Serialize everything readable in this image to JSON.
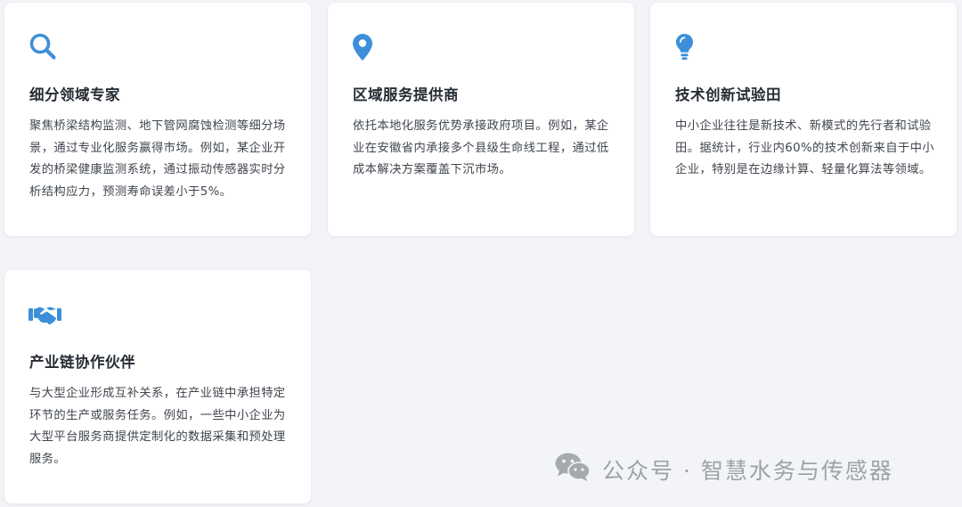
{
  "theme": {
    "accent": "#3d8fd9",
    "card_background": "#ffffff",
    "page_background": "#f3f4f8"
  },
  "cards": [
    {
      "icon": "search-icon",
      "title": "细分领域专家",
      "description": "聚焦桥梁结构监测、地下管网腐蚀检测等细分场景，通过专业化服务赢得市场。例如，某企业开发的桥梁健康监测系统，通过振动传感器实时分析结构应力，预测寿命误差小于5%。"
    },
    {
      "icon": "map-pin-icon",
      "title": "区域服务提供商",
      "description": "依托本地化服务优势承接政府项目。例如，某企业在安徽省内承接多个县级生命线工程，通过低成本解决方案覆盖下沉市场。"
    },
    {
      "icon": "lightbulb-icon",
      "title": "技术创新试验田",
      "description": "中小企业往往是新技术、新模式的先行者和试验田。据统计，行业内60%的技术创新来自于中小企业，特别是在边缘计算、轻量化算法等领域。"
    },
    {
      "icon": "handshake-icon",
      "title": "产业链协作伙伴",
      "description": "与大型企业形成互补关系，在产业链中承担特定环节的生产或服务任务。例如，一些中小企业为大型平台服务商提供定制化的数据采集和预处理服务。"
    }
  ],
  "watermark": {
    "icon": "wechat-icon",
    "text": "公众号 · 智慧水务与传感器"
  }
}
